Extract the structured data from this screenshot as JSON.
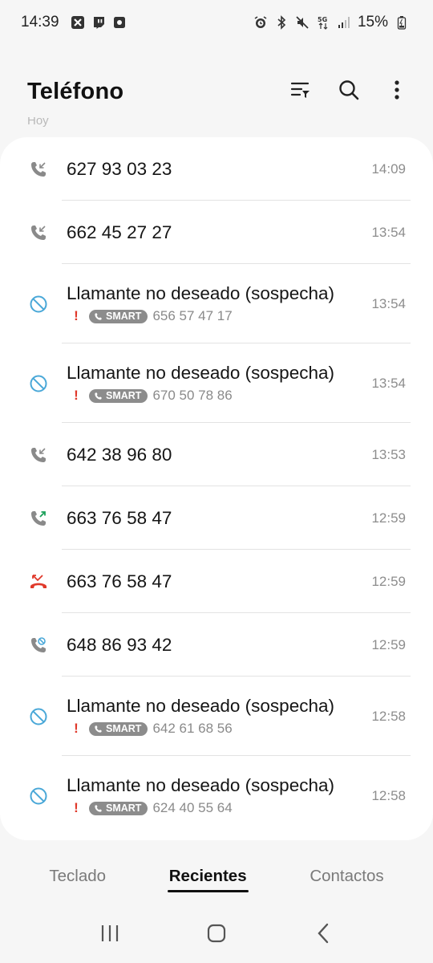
{
  "status_bar": {
    "time": "14:39",
    "battery": "15%",
    "left_icons": [
      "x-app-icon",
      "twitch-icon",
      "screen-record-icon"
    ],
    "right_icons": [
      "alarm-icon",
      "bluetooth-icon",
      "mute-icon",
      "5g-icon",
      "signal-icon",
      "battery-icon"
    ]
  },
  "header": {
    "title": "Teléfono",
    "section_peek": "Hoy"
  },
  "calls": [
    {
      "type": "incoming",
      "title": "627 93 03 23",
      "time": "14:09"
    },
    {
      "type": "incoming",
      "title": "662 45 27 27",
      "time": "13:54"
    },
    {
      "type": "blocked",
      "title": "Llamante no deseado (sospecha)",
      "badge": "SMART",
      "number": "656 57 47 17",
      "time": "13:54"
    },
    {
      "type": "blocked",
      "title": "Llamante no deseado (sospecha)",
      "badge": "SMART",
      "number": "670 50 78 86",
      "time": "13:54"
    },
    {
      "type": "incoming",
      "title": "642 38 96 80",
      "time": "13:53"
    },
    {
      "type": "outgoing",
      "title": "663 76 58 47",
      "time": "12:59"
    },
    {
      "type": "missed",
      "title": "663 76 58 47",
      "time": "12:59"
    },
    {
      "type": "rejected",
      "title": "648 86 93 42",
      "time": "12:59"
    },
    {
      "type": "blocked",
      "title": "Llamante no deseado (sospecha)",
      "badge": "SMART",
      "number": "642 61 68 56",
      "time": "12:58"
    },
    {
      "type": "blocked",
      "title": "Llamante no deseado (sospecha)",
      "badge": "SMART",
      "number": "624 40 55 64",
      "time": "12:58"
    }
  ],
  "warning_mark": "!",
  "tabs": [
    {
      "label": "Teclado",
      "active": false
    },
    {
      "label": "Recientes",
      "active": true
    },
    {
      "label": "Contactos",
      "active": false
    }
  ],
  "colors": {
    "background": "#f6f6f6",
    "card": "#ffffff",
    "missed": "#e0392b",
    "outgoing_arrow": "#1ca05a",
    "blocked": "#4aa8d8",
    "badge": "#8c8c8c"
  }
}
